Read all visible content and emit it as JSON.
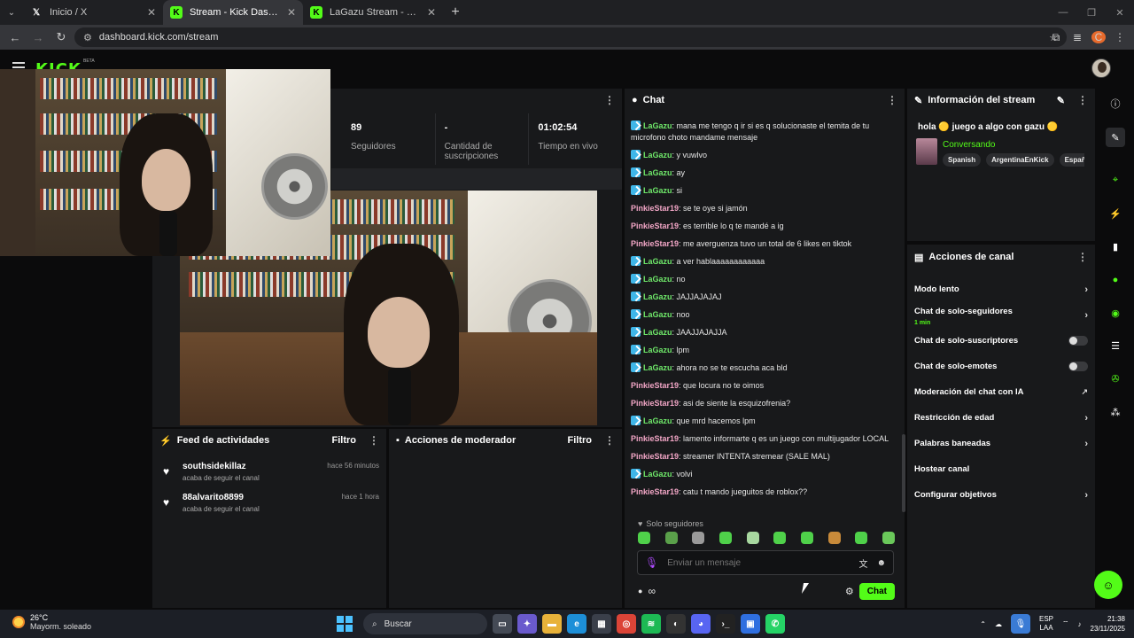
{
  "browser": {
    "tabs": [
      {
        "title": "Inicio / X",
        "icon": "X"
      },
      {
        "title": "Stream - Kick Dashboard",
        "icon": "K"
      },
      {
        "title": "LaGazu Stream - Watch Live on",
        "icon": "K"
      }
    ],
    "url": "dashboard.kick.com/stream",
    "profile_initial": "C"
  },
  "header": {
    "logo": "KICK",
    "beta": "BETA"
  },
  "stats": [
    {
      "value": "89",
      "label": "Seguidores"
    },
    {
      "value": "-",
      "label": "Cantidad de suscripciones"
    },
    {
      "value": "01:02:54",
      "label": "Tiempo en vivo"
    }
  ],
  "activity_feed": {
    "title": "Feed de actividades",
    "filter": "Filtro",
    "items": [
      {
        "name": "southsidekillaz",
        "action": "acaba de seguir el canal",
        "time": "hace 56 minutos"
      },
      {
        "name": "88alvarito8899",
        "action": "acaba de seguir el canal",
        "time": "hace 1 hora"
      }
    ]
  },
  "mod_actions": {
    "title": "Acciones de moderador",
    "filter": "Filtro"
  },
  "chat": {
    "title": "Chat",
    "messages": [
      {
        "user": "LaGazu",
        "badge": true,
        "text": "mana me tengo q ir si es q solucionaste el temita de tu microfono choto mandame mensaje"
      },
      {
        "user": "LaGazu",
        "badge": true,
        "text": "y vuwlvo"
      },
      {
        "user": "LaGazu",
        "badge": true,
        "text": "ay"
      },
      {
        "user": "LaGazu",
        "badge": true,
        "text": "si"
      },
      {
        "user": "PinkieStar19",
        "badge": false,
        "text": "se te oye si jamón"
      },
      {
        "user": "PinkieStar19",
        "badge": false,
        "text": "es terrible lo q te mandé a ig"
      },
      {
        "user": "PinkieStar19",
        "badge": false,
        "text": "me averguenza tuvo un total de 6 likes en tiktok"
      },
      {
        "user": "LaGazu",
        "badge": true,
        "text": "a ver hablaaaaaaaaaaaa"
      },
      {
        "user": "LaGazu",
        "badge": true,
        "text": "no"
      },
      {
        "user": "LaGazu",
        "badge": true,
        "text": "JAJJAJAJAJ"
      },
      {
        "user": "LaGazu",
        "badge": true,
        "text": "noo"
      },
      {
        "user": "LaGazu",
        "badge": true,
        "text": "JAAJJAJAJJA"
      },
      {
        "user": "LaGazu",
        "badge": true,
        "text": "lpm"
      },
      {
        "user": "LaGazu",
        "badge": true,
        "text": "ahora no se te escucha aca bld"
      },
      {
        "user": "PinkieStar19",
        "badge": false,
        "text": "que locura no te oimos"
      },
      {
        "user": "PinkieStar19",
        "badge": false,
        "text": "asi de siente la esquizofrenia?"
      },
      {
        "user": "LaGazu",
        "badge": true,
        "text": "que mrd hacemos lpm"
      },
      {
        "user": "PinkieStar19",
        "badge": false,
        "text": "lamento informarte q es un juego con multijugador LOCAL"
      },
      {
        "user": "PinkieStar19",
        "badge": false,
        "text": "streamer INTENTA stremear (SALE MAL)"
      },
      {
        "user": "LaGazu",
        "badge": true,
        "text": "volvi"
      },
      {
        "user": "PinkieStar19",
        "badge": false,
        "text": "catu t mando jueguitos de roblox??"
      }
    ],
    "solo_seguidores": "Solo seguidores",
    "input_placeholder": "Enviar un mensaje",
    "send_label": "Chat",
    "infinity": "∞"
  },
  "stream_info": {
    "title": "Información del stream",
    "stream_title": "hola 🟡 juego a algo con gazu 🟡",
    "category": "Conversando",
    "tags": [
      "Spanish",
      "ArgentinaEnKick",
      "Español"
    ]
  },
  "channel_actions": {
    "title": "Acciones de canal",
    "items": [
      {
        "label": "Modo lento",
        "type": "chevron",
        "sub": ""
      },
      {
        "label": "Chat de solo-seguidores",
        "type": "chevron",
        "sub": "1 min"
      },
      {
        "label": "Chat de solo-suscriptores",
        "type": "toggle",
        "sub": ""
      },
      {
        "label": "Chat de solo-emotes",
        "type": "toggle",
        "sub": ""
      },
      {
        "label": "Moderación del chat con IA",
        "type": "external",
        "sub": ""
      },
      {
        "label": "Restricción de edad",
        "type": "chevron",
        "sub": ""
      },
      {
        "label": "Palabras baneadas",
        "type": "chevron",
        "sub": ""
      },
      {
        "label": "Hostear canal",
        "type": "none",
        "sub": ""
      },
      {
        "label": "Configurar objetivos",
        "type": "chevron",
        "sub": ""
      }
    ]
  },
  "taskbar": {
    "temp": "26°C",
    "weather": "Mayorm. soleado",
    "search": "Buscar",
    "lang1": "ESP",
    "lang2": "LAA",
    "time": "21:38",
    "date": "23/11/2025"
  },
  "colors": {
    "accent": "#53fc18",
    "gazu": "#6fe86a",
    "pinkie": "#f2a6c6"
  }
}
